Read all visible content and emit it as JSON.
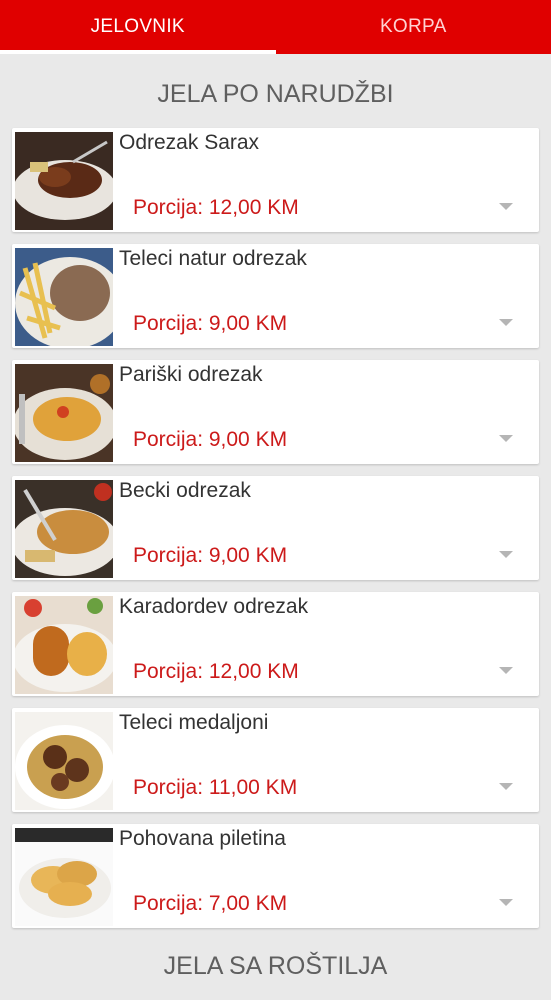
{
  "tabs": [
    {
      "label": "JELOVNIK",
      "active": true
    },
    {
      "label": "KORPA",
      "active": false
    }
  ],
  "accent_color": "#e00000",
  "price_color": "#cc1a1a",
  "sections": [
    {
      "title": "JELA PO NARUDŽBI",
      "items": [
        {
          "name": "Odrezak Sarax",
          "price": "Porcija: 12,00 KM",
          "image": "steak-with-sauce-photo"
        },
        {
          "name": "Teleci natur odrezak",
          "price": "Porcija: 9,00 KM",
          "image": "veal-steak-with-fries-photo"
        },
        {
          "name": "Pariški odrezak",
          "price": "Porcija: 9,00 KM",
          "image": "breaded-cutlet-photo"
        },
        {
          "name": "Becki odrezak",
          "price": "Porcija: 9,00 KM",
          "image": "schnitzel-photo"
        },
        {
          "name": "Karadordev odrezak",
          "price": "Porcija: 12,00 KM",
          "image": "rolled-cutlet-photo"
        },
        {
          "name": "Teleci medaljoni",
          "price": "Porcija: 11,00 KM",
          "image": "medallions-pasta-photo"
        },
        {
          "name": "Pohovana piletina",
          "price": "Porcija: 7,00 KM",
          "image": "breaded-chicken-photo"
        }
      ]
    },
    {
      "title": "JELA SA ROŠTILJA",
      "items": []
    }
  ]
}
